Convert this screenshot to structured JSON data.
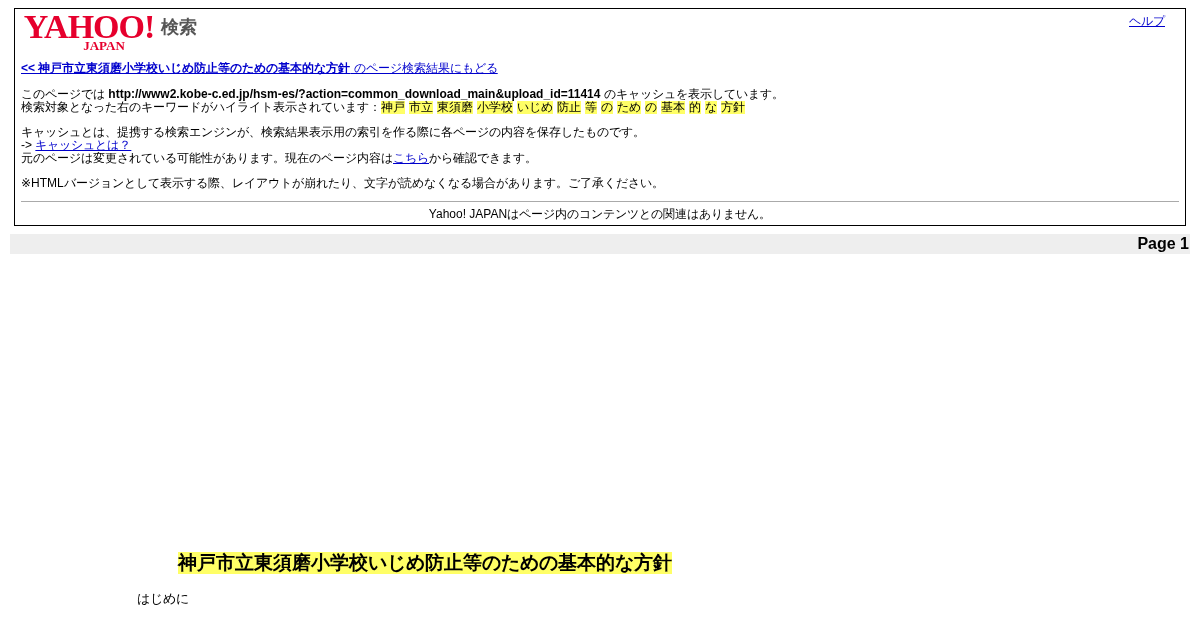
{
  "header": {
    "logo_text": "YAHOO!",
    "logo_sub": "JAPAN",
    "logo_label": "検索",
    "help_link": "ヘルプ"
  },
  "back_link": "**<< 神戸市立東須磨小学校いじめ防止等のための基本的な方針** のページ検索結果にもどる",
  "cache_line": "このページでは **http://www2.kobe-c.ed.jp/hsm-es/?action=common_download_main&upload_id=11414** のキャッシュを表示しています。",
  "keyword_intro": "検索対象となった右のキーワードがハイライト表示されています：",
  "keywords": [
    "神戸",
    "市立",
    "東須磨",
    "小学校",
    "いじめ",
    "防止",
    "等",
    "の",
    "ため",
    "の",
    "基本",
    "的",
    "な",
    "方針"
  ],
  "explanation": "キャッシュとは、提携する検索エンジンが、検索結果表示用の索引を作る際に各ページの内容を保存したものです。",
  "about_arrow": "->",
  "about_link": "キャッシュとは？",
  "change_note": {
    "before": "元のページは変更されている可能性があります。現在のページ内容は",
    "link": "こちら",
    "after": "から確認できます。"
  },
  "notice": "※HTMLバージョンとして表示する際、レイアウトが崩れたり、文字が読めなくなる場合があります。ご了承ください。",
  "disclaimer": "Yahoo! JAPANはページ内のコンテンツとの関連はありません。",
  "page_label": "Page 1",
  "document": {
    "title": "神戸市立東須磨小学校いじめ防止等のための基本的な方針",
    "paragraph": "はじめに"
  }
}
